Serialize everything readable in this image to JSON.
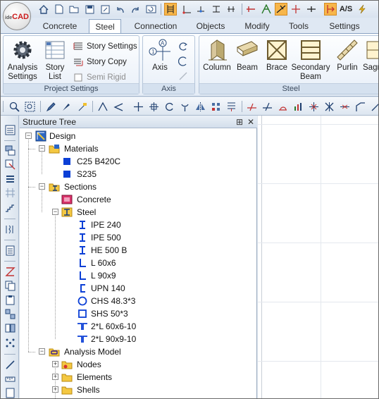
{
  "app": {
    "logo_prefix": "ide",
    "logo_main": "CAD"
  },
  "qat": {
    "icons": [
      "home-icon",
      "new-file-icon",
      "open-folder-icon",
      "save-icon",
      "save-as-icon",
      "undo-icon",
      "redo-icon",
      "refresh-icon",
      "snap-grid-icon",
      "axis-icon",
      "snap-point-icon",
      "dimension-icon",
      "dimension-h-icon",
      "beam-end-icon",
      "structure-icon",
      "member-icon",
      "column-top-icon",
      "beam-line-icon",
      "highlight-icon",
      "as-label-icon",
      "lightning-icon"
    ],
    "as_label": "A/S"
  },
  "tabs": [
    "Concrete",
    "Steel",
    "Connection",
    "Objects",
    "Modify",
    "Tools",
    "Settings"
  ],
  "active_tab": "Steel",
  "ribbon": {
    "project_settings": {
      "label": "Project Settings",
      "analysis_settings": "Analysis\nSettings",
      "story_list": "Story\nList",
      "story_settings": "Story Settings",
      "story_copy": "Story Copy",
      "semi_rigid": "Semi Rigid"
    },
    "axis": {
      "label": "Axis",
      "axis_button": "Axis"
    },
    "steel": {
      "label": "Steel",
      "column": "Column",
      "beam": "Beam",
      "brace": "Brace",
      "secondary_beam": "Secondary\nBeam",
      "purlin": "Purlin",
      "sag": "Sagr"
    }
  },
  "panel": {
    "title": "Structure Tree",
    "pin": "⊞",
    "close": "✕"
  },
  "tree": {
    "design": "Design",
    "materials": "Materials",
    "material_items": [
      "C25 B420C",
      "S235"
    ],
    "sections": "Sections",
    "concrete": "Concrete",
    "steel": "Steel",
    "steel_items": [
      {
        "label": "IPE 240",
        "icon": "i-section-icon"
      },
      {
        "label": "IPE 500",
        "icon": "i-section-icon"
      },
      {
        "label": "HE 500 B",
        "icon": "i-section-icon"
      },
      {
        "label": "L 60x6",
        "icon": "angle-section-icon"
      },
      {
        "label": "L 90x9",
        "icon": "angle-section-icon"
      },
      {
        "label": "UPN 140",
        "icon": "channel-section-icon"
      },
      {
        "label": "CHS 48.3*3",
        "icon": "circular-hollow-icon"
      },
      {
        "label": "SHS 50*3",
        "icon": "square-hollow-icon"
      },
      {
        "label": "2*L 60x6-10",
        "icon": "double-angle-icon"
      },
      {
        "label": "2*L 90x9-10",
        "icon": "double-angle-icon"
      }
    ],
    "analysis_model": "Analysis Model",
    "analysis_items": [
      "Nodes",
      "Elements",
      "Shells"
    ]
  },
  "colors": {
    "accent": "#f7b64a",
    "tree_blue": "#0b3fd6",
    "tab_border": "#8ba3c2"
  }
}
